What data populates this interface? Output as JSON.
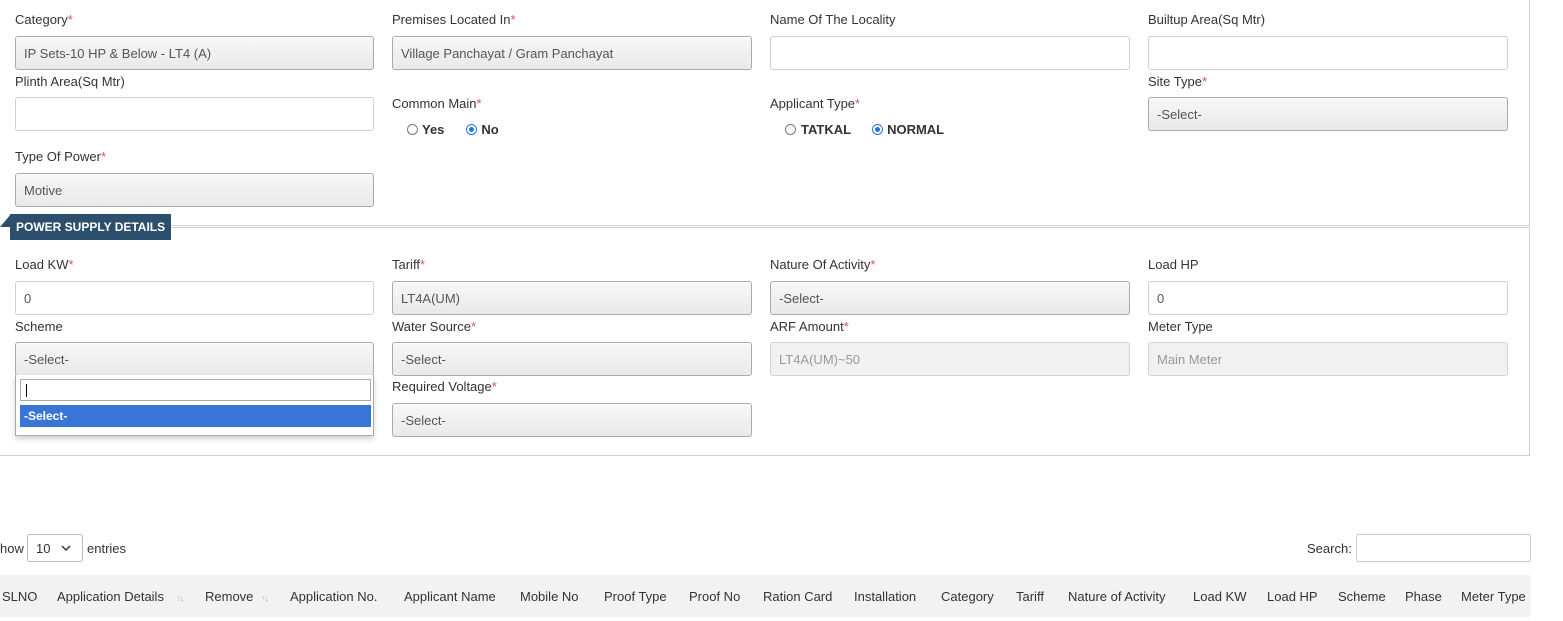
{
  "form": {
    "category_label": "Category",
    "category_value": "IP Sets-10 HP & Below - LT4 (A)",
    "premises_label": "Premises Located In",
    "premises_value": "Village Panchayat / Gram Panchayat",
    "locality_label": "Name Of The Locality",
    "locality_value": "",
    "builtup_label": "Builtup Area(Sq Mtr)",
    "builtup_value": "",
    "plinth_label": "Plinth Area(Sq Mtr)",
    "plinth_value": "",
    "common_main_label": "Common Main",
    "common_main_options": [
      "Yes",
      "No"
    ],
    "common_main_selected": "No",
    "applicant_type_label": "Applicant Type",
    "applicant_type_options": [
      "TATKAL",
      "NORMAL"
    ],
    "applicant_type_selected": "NORMAL",
    "site_type_label": "Site Type",
    "site_type_value": "-Select-",
    "type_of_power_label": "Type Of Power",
    "type_of_power_value": "Motive",
    "required_mark": "*"
  },
  "power_supply": {
    "section_title": "POWER SUPPLY DETAILS",
    "load_kw_label": "Load KW",
    "load_kw_value": "0",
    "tariff_label": "Tariff",
    "tariff_value": "LT4A(UM)",
    "nature_label": "Nature Of Activity",
    "nature_value": "-Select-",
    "load_hp_label": "Load HP",
    "load_hp_value": "0",
    "scheme_label": "Scheme",
    "scheme_value": "-Select-",
    "scheme_dropdown": {
      "search_value": "",
      "options": [
        "-Select-"
      ],
      "highlighted": "-Select-"
    },
    "water_source_label": "Water Source",
    "water_source_value": "-Select-",
    "arf_label": "ARF Amount",
    "arf_placeholder": "LT4A(UM)~50",
    "meter_type_label": "Meter Type",
    "meter_type_placeholder": "Main Meter",
    "required_voltage_label": "Required Voltage",
    "required_voltage_value": "-Select-"
  },
  "table": {
    "show_prefix": "how",
    "entries_value": "10",
    "entries_suffix": "entries",
    "search_label": "Search:",
    "search_value": "",
    "columns": [
      "SLNO",
      "Application Details",
      "Remove",
      "Application No.",
      "Applicant Name",
      "Mobile No",
      "Proof Type",
      "Proof No",
      "Ration Card",
      "Installation",
      "Category",
      "Tariff",
      "Nature of Activity",
      "Load KW",
      "Load HP",
      "Scheme",
      "Phase",
      "Meter Type"
    ],
    "sort_icon": "↑↓"
  },
  "colors": {
    "section_tag_bg": "#2c4f6d",
    "dropdown_highlight": "#3875d7",
    "required": "#d9534f"
  }
}
